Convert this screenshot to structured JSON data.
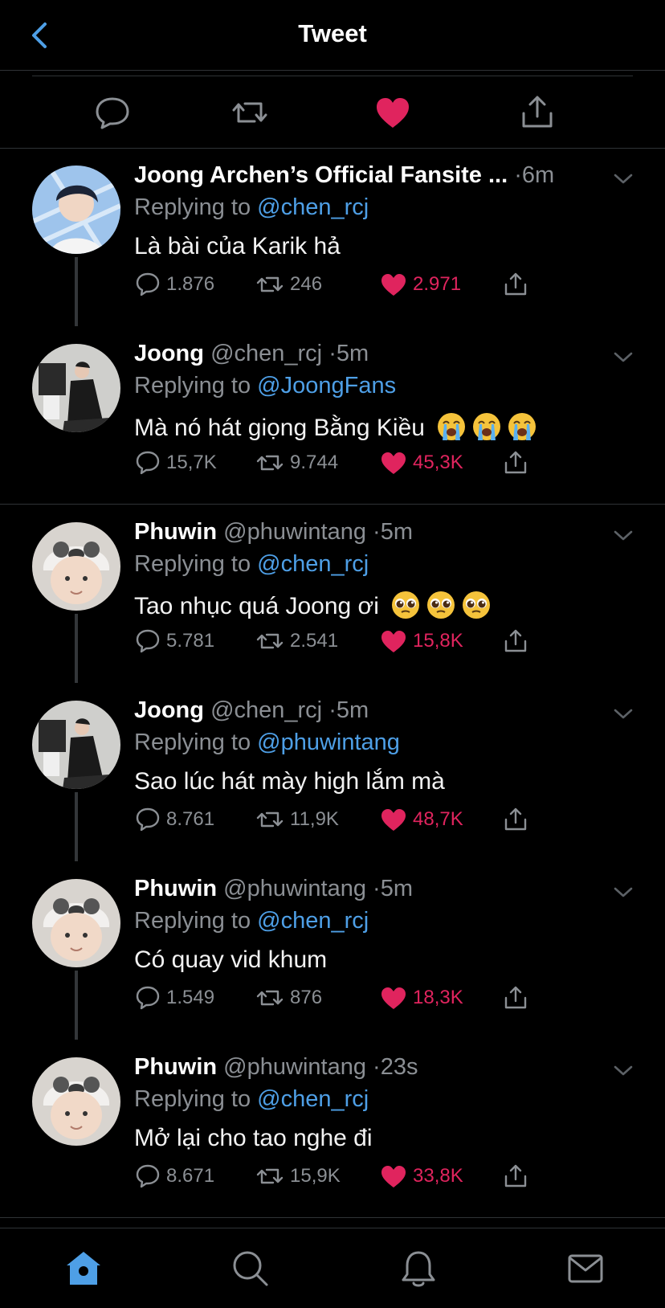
{
  "header": {
    "title": "Tweet",
    "back_icon": "chevron-left-icon"
  },
  "colors": {
    "background": "#000000",
    "accent_blue": "#4e9fe6",
    "like_pink": "#e0245e",
    "muted": "#8b8f94",
    "divider": "#2f3336"
  },
  "action_bar": {
    "icons": [
      "reply-icon",
      "retweet-icon",
      "liked-heart-icon",
      "share-icon"
    ]
  },
  "tweets": [
    {
      "name": "Joong Archen’s Official Fansite ...",
      "handle": "",
      "dot": "·",
      "time": "6m",
      "replying_label": "Replying to",
      "replying_to": "@chen_rcj",
      "text": "Là bài của Karik hả",
      "emojis": "",
      "replies": "1.876",
      "retweets": "246",
      "likes": "2.971"
    },
    {
      "name": "Joong",
      "handle": "@chen_rcj",
      "dot": "·",
      "time": "5m",
      "replying_label": "Replying to",
      "replying_to": "@JoongFans",
      "text": "Mà nó hát giọng Bằng Kiều",
      "emojis": "😭😭😭",
      "replies": "15,7K",
      "retweets": "9.744",
      "likes": "45,3K"
    },
    {
      "name": "Phuwin",
      "handle": "@phuwintang",
      "dot": "·",
      "time": "5m",
      "replying_label": "Replying to",
      "replying_to": "@chen_rcj",
      "text": "Tao nhục quá Joong ơi",
      "emojis": "🥺🥺🥺",
      "replies": "5.781",
      "retweets": "2.541",
      "likes": "15,8K"
    },
    {
      "name": "Joong",
      "handle": "@chen_rcj",
      "dot": "·",
      "time": "5m",
      "replying_label": "Replying to",
      "replying_to": "@phuwintang",
      "text": "Sao lúc hát mày high lắm mà",
      "emojis": "",
      "replies": "8.761",
      "retweets": "11,9K",
      "likes": "48,7K"
    },
    {
      "name": "Phuwin",
      "handle": "@phuwintang",
      "dot": "·",
      "time": "5m",
      "replying_label": "Replying to",
      "replying_to": "@chen_rcj",
      "text": "Có quay vid khum",
      "emojis": "",
      "replies": "1.549",
      "retweets": "876",
      "likes": "18,3K"
    },
    {
      "name": "Phuwin",
      "handle": "@phuwintang",
      "dot": "·",
      "time": "23s",
      "replying_label": "Replying to",
      "replying_to": "@chen_rcj",
      "text": "Mở lại cho tao nghe đi",
      "emojis": "",
      "replies": "8.671",
      "retweets": "15,9K",
      "likes": "33,8K"
    }
  ],
  "tab_bar": {
    "tabs": [
      "home-icon",
      "search-icon",
      "notifications-bell-icon",
      "messages-envelope-icon"
    ],
    "active": "home-icon"
  }
}
